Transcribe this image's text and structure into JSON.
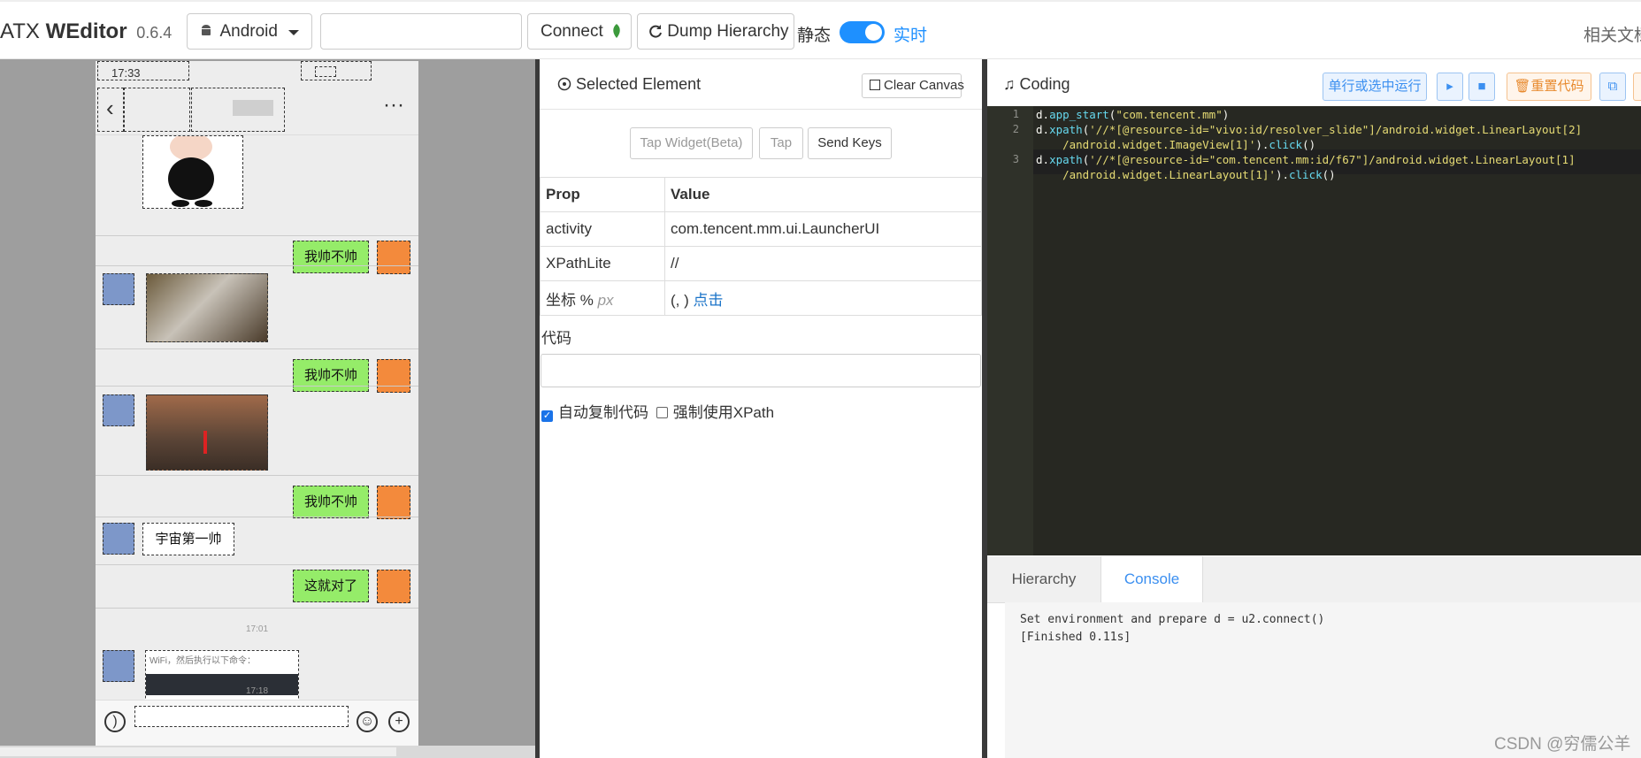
{
  "app": {
    "brand_prefix": "ATX",
    "brand_name": "WEditor",
    "version": "0.6.4"
  },
  "toolbar": {
    "platform": "Android",
    "device_input_value": "",
    "connect_label": "Connect",
    "dump_label": "Dump Hierarchy",
    "static_label": "静态",
    "live_label": "实时",
    "live_on": true,
    "docs_label": "相关文档"
  },
  "phone": {
    "status_time": "17:33",
    "messages": [
      {
        "side": "right",
        "kind": "text",
        "text": "我帅不帅"
      },
      {
        "side": "left",
        "kind": "image"
      },
      {
        "side": "right",
        "kind": "text",
        "text": "我帅不帅"
      },
      {
        "side": "left",
        "kind": "image"
      },
      {
        "side": "right",
        "kind": "text",
        "text": "我帅不帅"
      },
      {
        "side": "left",
        "kind": "text",
        "text": "宇宙第一帅"
      },
      {
        "side": "right",
        "kind": "text",
        "text": "这就对了"
      }
    ],
    "time_sep_1": "17:01",
    "card_text": "WiFi，然后执行以下命令：",
    "time_sep_2": "17:18"
  },
  "selected": {
    "title": "Selected Element",
    "clear_label": "Clear Canvas",
    "tap_widget_label": "Tap Widget(Beta)",
    "tap_label": "Tap",
    "send_keys_label": "Send Keys",
    "col_prop": "Prop",
    "col_value": "Value",
    "rows": {
      "activity_prop": "activity",
      "activity_value": "com.tencent.mm.ui.LauncherUI",
      "xpath_prop": "XPathLite",
      "xpath_value": "//",
      "coord_prop": "坐标 %",
      "coord_unit": "px",
      "coord_value": "(, )",
      "coord_click": "点击"
    },
    "code_label": "代码",
    "code_value": "",
    "auto_copy_label": "自动复制代码",
    "auto_copy_checked": true,
    "force_xpath_label": "强制使用XPath",
    "force_xpath_checked": false
  },
  "coding": {
    "title": "Coding",
    "run_label": "单行或选中运行",
    "reset_label": "重置代码",
    "code_lines": [
      "d.app_start(\"com.tencent.mm\")",
      "d.xpath('//*[@resource-id=\"vivo:id/resolver_slide\"]/android.widget.LinearLayout[2]",
      "    /android.widget.ImageView[1]').click()",
      "d.xpath('//*[@resource-id=\"com.tencent.mm:id/f67\"]/android.widget.LinearLayout[1]",
      "    /android.widget.LinearLayout[1]').click()"
    ],
    "line_numbers": [
      "1",
      "2",
      "3"
    ]
  },
  "bottom_tabs": {
    "hierarchy": "Hierarchy",
    "console": "Console",
    "active": "Console"
  },
  "console": {
    "lines": [
      "Set environment and prepare d = u2.connect()",
      "[Finished 0.11s]"
    ]
  },
  "watermark": "CSDN @穷儒公羊",
  "colors": {
    "accent": "#1e90ff",
    "bubble_green": "#95ec69",
    "editor_bg": "#272822"
  }
}
